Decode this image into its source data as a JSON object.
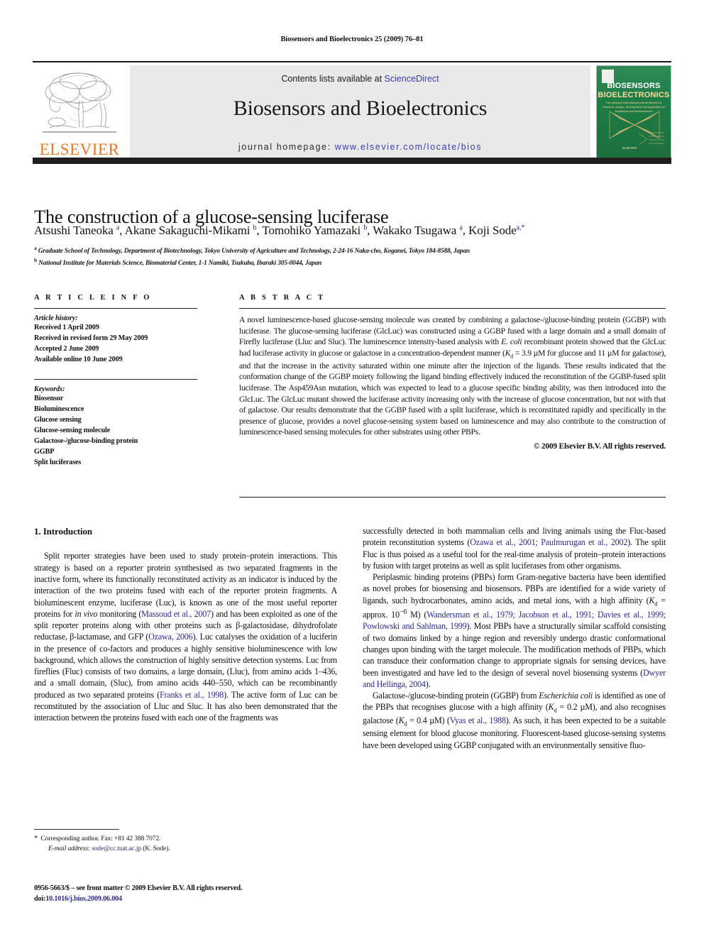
{
  "running_head": "Biosensors and Bioelectronics 25 (2009) 76–81",
  "masthead": {
    "contents_prefix": "Contents lists available at ",
    "sciencedirect": "ScienceDirect",
    "journal_title": "Biosensors and Bioelectronics",
    "homepage_prefix": "journal homepage: ",
    "homepage_url": "www.elsevier.com/locate/bios",
    "publisher_wordmark": "ELSEVIER",
    "cover": {
      "line1": "BIOSENSORS",
      "line2": "BIOELECTRONICS",
      "subtitle": "The principal international journal devoted to research, design, development and application of biosensors and bioelectronics",
      "footer": "ELSEVIER"
    },
    "accent_orange": "#E87722",
    "link_blue": "#3b3bb0",
    "cover_green": "#1f7a46"
  },
  "article": {
    "title": "The construction of a glucose-sensing luciferase",
    "authors_html": "Atsushi Taneoka <sup>a</sup>, Akane Sakaguchi-Mikami <sup>b</sup>, Tomohiko Yamazaki <sup>b</sup>, Wakako Tsugawa <sup>a</sup>, Koji Sode<sup>a,</sup><sup>*</sup>",
    "affiliation_a": "Graduate School of Technology, Department of Biotechnology, Tokyo University of Agriculture and Technology, 2-24-16 Naka-cho, Koganei, Tokyo 184-8588, Japan",
    "affiliation_b": "National Institute for Materials Science, Biomaterial Center, 1-1 Namiki, Tsukuba, Ibaraki 305-0044, Japan"
  },
  "article_info": {
    "heading": "A R T I C L E    I N F O",
    "history_label": "Article history:",
    "history": [
      "Received 1 April 2009",
      "Received in revised form 29 May 2009",
      "Accepted 2 June 2009",
      "Available online 10 June 2009"
    ],
    "keywords_label": "Keywords:",
    "keywords": [
      "Biosensor",
      "Bioluminescence",
      "Glucose sensing",
      "Glucose-sensing molecule",
      "Galactose-/glucose-binding protein",
      "GGBP",
      "Split luciferases"
    ]
  },
  "abstract": {
    "heading": "A B S T R A C T",
    "body_html": "A novel luminescence-based glucose-sensing molecule was created by combining a galactose-/glucose-binding protein (GGBP) with luciferase. The glucose-sensing luciferase (GlcLuc) was constructed using a GGBP fused with a large domain and a small domain of Firefly luciferase (Lluc and Sluc). The luminescence intensity-based analysis with <i>E. coli</i> recombinant protein showed that the GlcLuc had luciferase activity in glucose or galactose in a concentration-dependent manner (<span class=\"kd\">K<sub>d</sub></span> = 3.9 &micro;M for glucose and 11 &micro;M for galactose), and that the increase in the activity saturated within one minute after the injection of the ligands. These results indicated that the conformation change of the GGBP moiety following the ligand binding effectively induced the reconstitution of the GGBP-fused split luciferase. The Asp459Asn mutation, which was expected to lead to a glucose specific binding ability, was then introduced into the GlcLuc. The GlcLuc mutant showed the luciferase activity increasing only with the increase of glucose concentration, but not with that of galactose. Our results demonstrate that the GGBP fused with a split luciferase, which is reconstituted rapidly and specifically in the presence of glucose, provides a novel glucose-sensing system based on luminescence and may also contribute to the construction of luminescence-based sensing molecules for other substrates using other PBPs.",
    "copyright": "© 2009 Elsevier B.V. All rights reserved."
  },
  "body": {
    "section_heading": "1. Introduction",
    "left_paragraphs_html": [
      "Split reporter strategies have been used to study protein–protein interactions. This strategy is based on a reporter protein synthesised as two separated fragments in the inactive form, where its functionally reconstituted activity as an indicator is induced by the interaction of the two proteins fused with each of the reporter protein fragments. A bioluminescent enzyme, luciferase (Luc), is known as one of the most useful reporter proteins for <i>in vivo</i> monitoring (<span class=\"ref\">Massoud et al., 2007</span>) and has been exploited as one of the split reporter proteins along with other proteins such as &beta;-galactosidase, dihydrofolate reductase, &beta;-lactamase, and GFP (<span class=\"ref\">Ozawa, 2006</span>). Luc catalyses the oxidation of a luciferin in the presence of co-factors and produces a highly sensitive bioluminescence with low background, which allows the construction of highly sensitive detection systems. Luc from fireflies (Fluc) consists of two domains, a large domain, (Lluc), from amino acids 1–436, and a small domain, (Sluc), from amino acids 440–550, which can be recombinantly produced as two separated proteins (<span class=\"ref\">Franks et al., 1998</span>). The active form of Luc can be reconstituted by the association of Lluc and Sluc. It has also been demonstrated that the interaction between the proteins fused with each one of the fragments was"
    ],
    "right_paragraphs_html": [
      "successfully detected in both mammalian cells and living animals using the Fluc-based protein reconstitution systems (<span class=\"ref\">Ozawa et al., 2001; Paulmurugan et al., 2002</span>). The split Fluc is thus poised as a useful tool for the real-time analysis of protein–protein interactions by fusion with target proteins as well as split luciferases from other organisms.",
      "Periplasmic binding proteins (PBPs) form Gram-negative bacteria have been identified as novel probes for biosensing and biosensors. PBPs are identified for a wide variety of ligands, such hydrocarbonates, amino acids, and metal ions, with a high affinity (<span class=\"kd\">K<sub>d</sub></span> = approx. 10<sup>&minus;6</sup> M) (<span class=\"ref\">Wandersman et al., 1979; Jacobson et al., 1991; Davies et al., 1999; Powlowski and Sahlman, 1999</span>). Most PBPs have a structurally similar scaffold consisting of two domains linked by a hinge region and reversibly undergo drastic conformational changes upon binding with the target molecule. The modification methods of PBPs, which can transduce their conformation change to appropriate signals for sensing devices, have been investigated and have led to the design of several novel biosensing systems (<span class=\"ref\">Dwyer and Hellinga, 2004</span>).",
      "Galactose-/glucose-binding protein (GGBP) from <i>Escherichia coli</i> is identified as one of the PBPs that recognises glucose with a high affinity (<span class=\"kd\">K<sub>d</sub></span> = 0.2 &micro;M), and also recognises galactose (<span class=\"kd\">K<sub>d</sub></span> = 0.4 &micro;M) (<span class=\"ref\">Vyas et al., 1988</span>). As such, it has been expected to be a suitable sensing element for blood glucose monitoring. Fluorescent-based glucose-sensing systems have been developed using GGBP conjugated with an environmentally sensitive fluo-"
    ]
  },
  "footnotes": {
    "corresponding_html": "<span class=\"star\">*</span>&nbsp;&nbsp;Corresponding author. Fax: +81 42 388 7072.",
    "email_html": "<i>E-mail address:</i> <span class=\"mail\">sode@cc.tuat.ac.jp</span> (K. Sode).",
    "issn_line": "0956-5663/$ – see front matter © 2009 Elsevier B.V. All rights reserved.",
    "doi_prefix": "doi:",
    "doi": "10.1016/j.bios.2009.06.004"
  }
}
